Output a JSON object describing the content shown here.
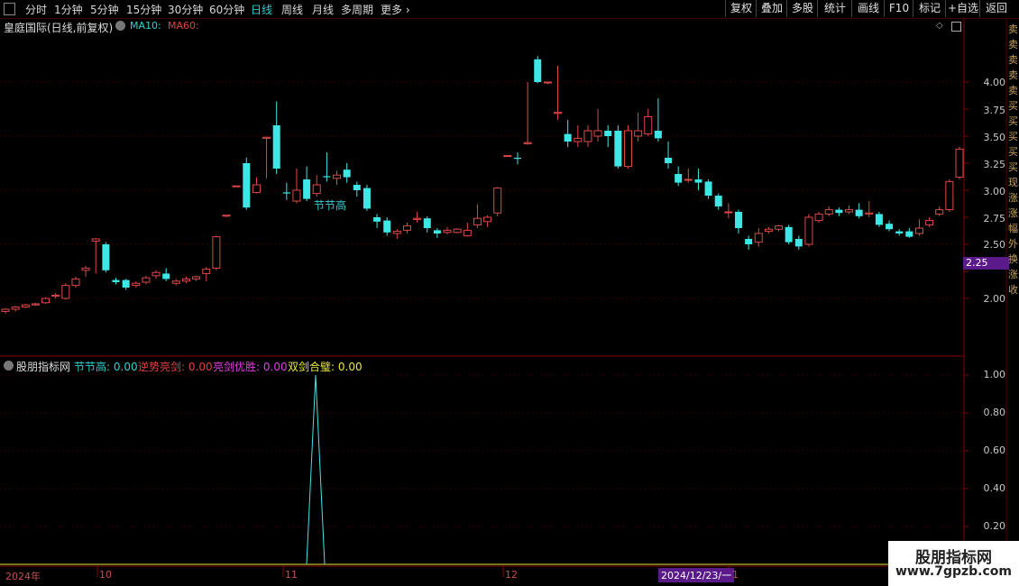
{
  "toolbar": {
    "left_items": [
      "分时",
      "1分钟",
      "5分钟",
      "15分钟",
      "30分钟",
      "60分钟",
      "日线",
      "周线",
      "月线",
      "多周期",
      "更多"
    ],
    "active_item": "日线",
    "right_items": [
      "复权",
      "叠加",
      "多股",
      "统计",
      "画线",
      "F10",
      "标记",
      "+自选",
      "返回"
    ]
  },
  "price_panel": {
    "title": "皇庭国际(日线,前复权)",
    "ma10_label": "MA10:",
    "ma60_label": "MA60:",
    "ma10_color": "#2fd0d0",
    "ma60_color": "#e04040",
    "y_ticks": [
      "4.00",
      "3.75",
      "3.50",
      "3.25",
      "3.00",
      "2.75",
      "2.50",
      "2.25",
      "2.00"
    ],
    "current_price": "2.25",
    "annotation": "节节高"
  },
  "indicator_panel": {
    "title": "股朋指标网",
    "items": [
      {
        "label": "节节高:",
        "value": "0.00",
        "color": "#2fd0d0"
      },
      {
        "label": "逆势亮剑:",
        "value": "0.00",
        "color": "#e04040"
      },
      {
        "label": "亮剑优胜:",
        "value": "0.00",
        "color": "#e040e0"
      },
      {
        "label": "双剑合璧:",
        "value": "0.00",
        "color": "#e8e840"
      }
    ],
    "y_ticks": [
      "1.00",
      "0.80",
      "0.60",
      "0.40",
      "0.20"
    ]
  },
  "x_axis": {
    "labels": [
      "2024年",
      "10",
      "11",
      "12",
      "1"
    ],
    "cursor_date": "2024/12/23/一"
  },
  "watermark": {
    "line1": "股朋指标网",
    "line2": "www.7gpzb.com"
  },
  "side_chars": "卖 卖 卖 卖 卖 买 买 买 买 买 现 涨 涨 幅 外 换 涨 收",
  "chart_data": {
    "type": "candlestick",
    "ylim": [
      1.9,
      4.3
    ],
    "indicator_ylim": [
      0,
      1.05
    ],
    "candles": [
      [
        1.88,
        1.9,
        1.86,
        1.91
      ],
      [
        1.9,
        1.92,
        1.88,
        1.93
      ],
      [
        1.92,
        1.94,
        1.91,
        1.95
      ],
      [
        1.94,
        1.95,
        1.93,
        1.96
      ],
      [
        1.96,
        2.0,
        1.95,
        2.01
      ],
      [
        2.02,
        2.03,
        2.0,
        2.05
      ],
      [
        2.0,
        2.12,
        1.99,
        2.14
      ],
      [
        2.12,
        2.18,
        2.1,
        2.2
      ],
      [
        2.26,
        2.28,
        2.2,
        2.3
      ],
      [
        2.53,
        2.55,
        2.23,
        2.56
      ],
      [
        2.5,
        2.26,
        2.24,
        2.52
      ],
      [
        2.17,
        2.15,
        2.13,
        2.19
      ],
      [
        2.17,
        2.1,
        2.08,
        2.18
      ],
      [
        2.12,
        2.14,
        2.1,
        2.16
      ],
      [
        2.15,
        2.19,
        2.13,
        2.21
      ],
      [
        2.21,
        2.24,
        2.18,
        2.26
      ],
      [
        2.23,
        2.18,
        2.16,
        2.28
      ],
      [
        2.14,
        2.16,
        2.12,
        2.18
      ],
      [
        2.16,
        2.18,
        2.14,
        2.2
      ],
      [
        2.18,
        2.2,
        2.16,
        2.21
      ],
      [
        2.23,
        2.27,
        2.16,
        2.29
      ],
      [
        2.28,
        2.57,
        2.26,
        2.58
      ],
      [
        2.76,
        2.77,
        2.75,
        2.77
      ],
      [
        3.04,
        3.04,
        3.03,
        3.04
      ],
      [
        3.25,
        2.84,
        2.82,
        3.3
      ],
      [
        2.98,
        3.05,
        2.97,
        3.12
      ],
      [
        3.48,
        3.49,
        3.11,
        3.49
      ],
      [
        3.6,
        3.2,
        3.15,
        3.82
      ],
      [
        2.98,
        2.97,
        2.91,
        3.07
      ],
      [
        2.9,
        3.0,
        2.88,
        3.2
      ],
      [
        3.1,
        2.92,
        2.9,
        3.22
      ],
      [
        2.97,
        3.05,
        2.94,
        3.14
      ],
      [
        3.13,
        3.12,
        3.08,
        3.35
      ],
      [
        3.11,
        3.14,
        3.05,
        3.18
      ],
      [
        3.19,
        3.12,
        3.07,
        3.25
      ],
      [
        3.05,
        3.0,
        2.94,
        3.08
      ],
      [
        3.02,
        2.83,
        2.81,
        3.05
      ],
      [
        2.75,
        2.71,
        2.65,
        2.78
      ],
      [
        2.72,
        2.61,
        2.58,
        2.75
      ],
      [
        2.6,
        2.62,
        2.55,
        2.64
      ],
      [
        2.63,
        2.67,
        2.6,
        2.7
      ],
      [
        2.73,
        2.74,
        2.7,
        2.8
      ],
      [
        2.74,
        2.65,
        2.61,
        2.76
      ],
      [
        2.63,
        2.6,
        2.56,
        2.65
      ],
      [
        2.61,
        2.63,
        2.59,
        2.66
      ],
      [
        2.61,
        2.64,
        2.6,
        2.65
      ],
      [
        2.58,
        2.63,
        2.57,
        2.7
      ],
      [
        2.68,
        2.74,
        2.65,
        2.87
      ],
      [
        2.71,
        2.75,
        2.66,
        2.77
      ],
      [
        2.79,
        3.02,
        2.76,
        3.03
      ],
      [
        3.32,
        3.32,
        3.31,
        3.32
      ],
      [
        3.3,
        3.29,
        3.24,
        3.35
      ],
      [
        3.43,
        3.44,
        3.42,
        4.0
      ],
      [
        4.21,
        4.0,
        3.99,
        4.24
      ],
      [
        4.0,
        4.0,
        3.98,
        4.0
      ],
      [
        3.71,
        3.72,
        3.65,
        4.15
      ],
      [
        3.52,
        3.45,
        3.4,
        3.65
      ],
      [
        3.45,
        3.48,
        3.4,
        3.6
      ],
      [
        3.45,
        3.55,
        3.4,
        3.6
      ],
      [
        3.5,
        3.55,
        3.45,
        3.75
      ],
      [
        3.55,
        3.5,
        3.4,
        3.6
      ],
      [
        3.55,
        3.22,
        3.2,
        3.6
      ],
      [
        3.22,
        3.55,
        3.2,
        3.6
      ],
      [
        3.5,
        3.55,
        3.45,
        3.72
      ],
      [
        3.52,
        3.68,
        3.5,
        3.75
      ],
      [
        3.55,
        3.48,
        3.45,
        3.85
      ],
      [
        3.3,
        3.25,
        3.2,
        3.45
      ],
      [
        3.15,
        3.07,
        3.04,
        3.22
      ],
      [
        3.1,
        3.1,
        3.07,
        3.2
      ],
      [
        3.1,
        3.07,
        3.0,
        3.2
      ],
      [
        3.08,
        2.95,
        2.92,
        3.1
      ],
      [
        2.95,
        2.85,
        2.82,
        2.97
      ],
      [
        2.8,
        2.8,
        2.74,
        2.88
      ],
      [
        2.8,
        2.65,
        2.6,
        2.82
      ],
      [
        2.55,
        2.5,
        2.45,
        2.58
      ],
      [
        2.52,
        2.6,
        2.48,
        2.65
      ],
      [
        2.62,
        2.64,
        2.6,
        2.66
      ],
      [
        2.64,
        2.67,
        2.62,
        2.68
      ],
      [
        2.66,
        2.52,
        2.5,
        2.68
      ],
      [
        2.55,
        2.48,
        2.45,
        2.58
      ],
      [
        2.5,
        2.75,
        2.48,
        2.78
      ],
      [
        2.72,
        2.78,
        2.7,
        2.8
      ],
      [
        2.78,
        2.82,
        2.76,
        2.85
      ],
      [
        2.82,
        2.79,
        2.76,
        2.84
      ],
      [
        2.8,
        2.82,
        2.78,
        2.86
      ],
      [
        2.82,
        2.76,
        2.74,
        2.88
      ],
      [
        2.78,
        2.79,
        2.75,
        2.9
      ],
      [
        2.78,
        2.68,
        2.66,
        2.8
      ],
      [
        2.69,
        2.64,
        2.62,
        2.72
      ],
      [
        2.62,
        2.6,
        2.58,
        2.64
      ],
      [
        2.62,
        2.57,
        2.56,
        2.65
      ],
      [
        2.6,
        2.65,
        2.58,
        2.73
      ],
      [
        2.68,
        2.72,
        2.66,
        2.75
      ],
      [
        2.78,
        2.82,
        2.76,
        2.85
      ],
      [
        2.82,
        3.08,
        2.8,
        3.1
      ],
      [
        3.12,
        3.38,
        3.1,
        3.4
      ]
    ],
    "indicator_series": [
      {
        "name": "节节高",
        "spike_index": 27,
        "value": 1.0
      }
    ]
  }
}
